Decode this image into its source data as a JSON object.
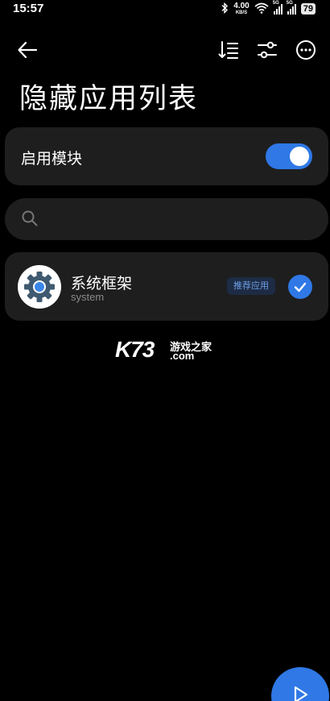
{
  "status_bar": {
    "time": "15:57",
    "net_speed_value": "4.00",
    "net_speed_unit": "KB/S",
    "sim1_tag": "5G",
    "sim2_tag": "5G",
    "battery": "79"
  },
  "header": {
    "title": "隐藏应用列表"
  },
  "module": {
    "label": "启用模块",
    "enabled": true
  },
  "search": {
    "placeholder": "",
    "value": ""
  },
  "apps": [
    {
      "name": "系统框架",
      "package": "system",
      "badge": "推荐应用",
      "checked": true
    }
  ],
  "watermark": {
    "logo": "K73",
    "cn": "游戏之家",
    "domain": ".com"
  },
  "colors": {
    "accent": "#2f78e6",
    "card_bg": "#1e1e1e",
    "page_bg": "#000000"
  },
  "icons": {
    "back": "arrow-left-icon",
    "sort": "sort-icon",
    "filter": "sliders-icon",
    "more": "more-horizontal-icon",
    "search": "search-icon",
    "app": "gear-icon",
    "check": "check-icon",
    "fab": "play-icon"
  }
}
